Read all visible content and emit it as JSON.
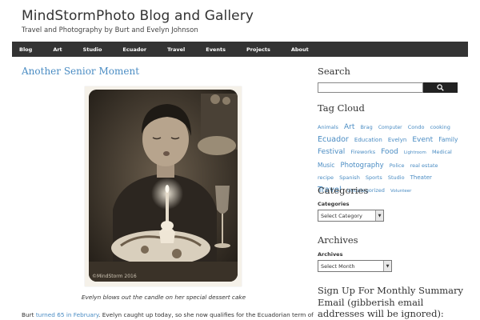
{
  "site": {
    "title": "MindStormPhoto Blog and Gallery",
    "description": "Travel and Photography by Burt and Evelyn Johnson"
  },
  "nav": [
    "Blog",
    "Art",
    "Studio",
    "Ecuador",
    "Travel",
    "Events",
    "Projects",
    "About"
  ],
  "post": {
    "title": "Another Senior Moment",
    "photo_watermark": "©MindStorm 2016",
    "caption": "Evelyn blows out the candle on her special dessert cake",
    "body_prefix": "Burt ",
    "body_link": "turned 65 in February",
    "body_suffix": ".  Evelyn caught up today, so she now qualifies for the Ecuadorian term of"
  },
  "sidebar": {
    "search_title": "Search",
    "search_value": "",
    "tagcloud_title": "Tag Cloud",
    "tags": [
      {
        "label": "Animals",
        "size": 6.5
      },
      {
        "label": "Art",
        "size": 9
      },
      {
        "label": "Brag",
        "size": 6.5
      },
      {
        "label": "Computer",
        "size": 6
      },
      {
        "label": "Condo",
        "size": 6.5
      },
      {
        "label": "cooking",
        "size": 6.5
      },
      {
        "label": "Ecuador",
        "size": 9.5
      },
      {
        "label": "Education",
        "size": 7
      },
      {
        "label": "Evelyn",
        "size": 7
      },
      {
        "label": "Event",
        "size": 9
      },
      {
        "label": "Family",
        "size": 7.5
      },
      {
        "label": "Festival",
        "size": 9
      },
      {
        "label": "Fireworks",
        "size": 6.5
      },
      {
        "label": "Food",
        "size": 9
      },
      {
        "label": "Lightroom",
        "size": 5.5
      },
      {
        "label": "Medical",
        "size": 6.5
      },
      {
        "label": "Music",
        "size": 7.5
      },
      {
        "label": "Photography",
        "size": 8.5
      },
      {
        "label": "Police",
        "size": 6.5
      },
      {
        "label": "real estate",
        "size": 6.5
      },
      {
        "label": "recipe",
        "size": 6.5
      },
      {
        "label": "Spanish",
        "size": 6.5
      },
      {
        "label": "Sports",
        "size": 6.5
      },
      {
        "label": "Studio",
        "size": 6.5
      },
      {
        "label": "Theater",
        "size": 7
      },
      {
        "label": "Travel",
        "size": 10
      },
      {
        "label": "Uncategorized",
        "size": 6.5
      },
      {
        "label": "Volunteer",
        "size": 5.5
      }
    ],
    "categories_title": "Categories",
    "categories_label": "Categories",
    "categories_selected": "Select Category",
    "archives_title": "Archives",
    "archives_label": "Archives",
    "archives_selected": "Select Month",
    "signup_title": "Sign Up For Monthly Summary Email (gibberish email addresses will be ignored):"
  },
  "colors": {
    "link": "#4a8cc3",
    "nav_bg": "#333333"
  }
}
